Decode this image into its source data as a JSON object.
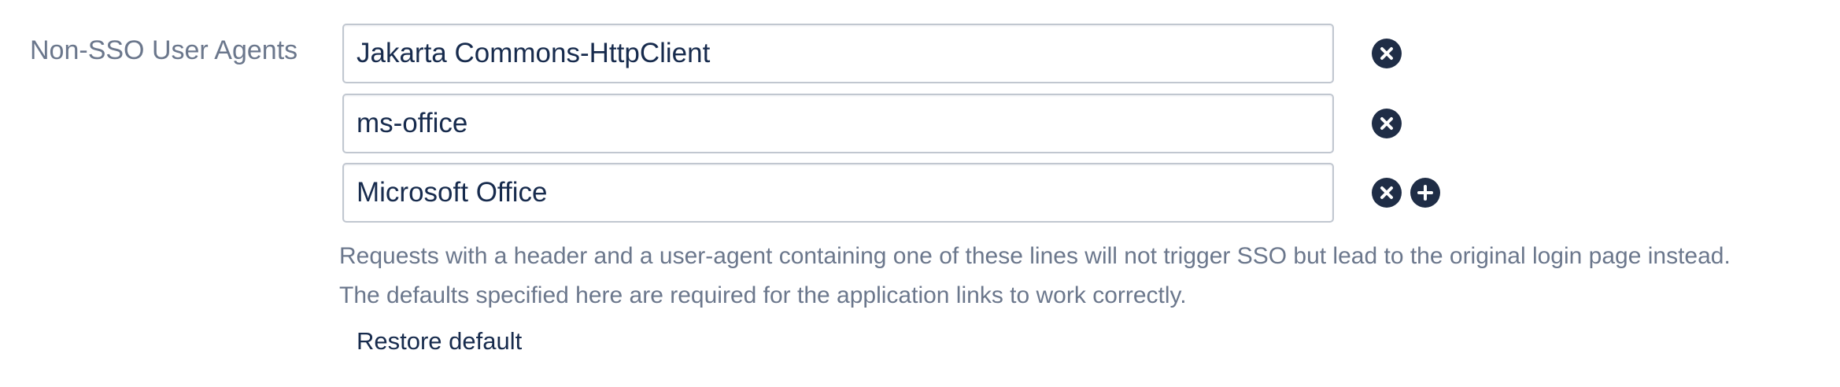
{
  "field": {
    "label": "Non-SSO User Agents",
    "agents": [
      {
        "value": "Jakarta Commons-HttpClient"
      },
      {
        "value": "ms-office"
      },
      {
        "value": "Microsoft Office"
      }
    ]
  },
  "help": {
    "line1": "Requests with a header and a user-agent containing one of these lines will not trigger SSO but lead to the original login page instead.",
    "line2": "The defaults specified here are required for the application links to work correctly."
  },
  "actions": {
    "restore_label": "Restore default"
  },
  "icons": {
    "remove": "close-circle-icon",
    "add": "plus-circle-icon"
  },
  "colors": {
    "icon_bg": "#1f2d46",
    "label": "#6b778c",
    "text": "#172b4d",
    "input_border": "#c1c7d0"
  }
}
